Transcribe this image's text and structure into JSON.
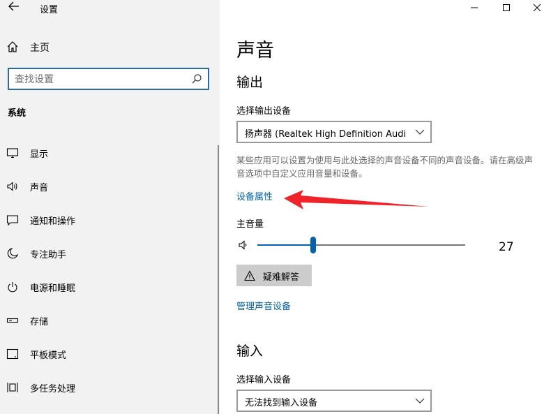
{
  "window": {
    "title": "设置"
  },
  "sidebar": {
    "home_label": "主页",
    "search_placeholder": "查找设置",
    "section_label": "系统",
    "items": [
      {
        "label": "显示",
        "icon": "display-icon"
      },
      {
        "label": "声音",
        "icon": "speaker-icon"
      },
      {
        "label": "通知和操作",
        "icon": "notification-icon"
      },
      {
        "label": "专注助手",
        "icon": "moon-icon"
      },
      {
        "label": "电源和睡眠",
        "icon": "power-icon"
      },
      {
        "label": "存储",
        "icon": "storage-icon"
      },
      {
        "label": "平板模式",
        "icon": "tablet-icon"
      },
      {
        "label": "多任务处理",
        "icon": "multitask-icon"
      }
    ]
  },
  "main": {
    "page_title": "声音",
    "output": {
      "heading": "输出",
      "select_label": "选择输出设备",
      "selected_device": "扬声器 (Realtek High Definition Audi...",
      "description": "某些应用可以设置为使用与此处选择的声音设备不同的声音设备。请在高级声音选项中自定义应用音量和设备。",
      "device_properties_link": "设备属性",
      "volume_label": "主音量",
      "volume_value": "27",
      "volume_level": 27,
      "troubleshoot_label": "疑难解答",
      "manage_devices_link": "管理声音设备"
    },
    "input": {
      "heading": "输入",
      "select_label": "选择输入设备",
      "selected_device": "无法找到输入设备"
    }
  },
  "colors": {
    "accent": "#0063b1",
    "annotation_arrow": "#f0222a",
    "sidebar_bg": "#f2f2f2"
  }
}
